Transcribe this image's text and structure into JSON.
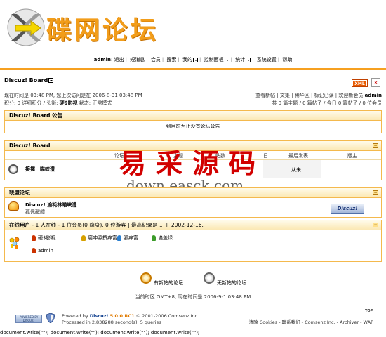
{
  "header": {
    "logo_text": "碟网论坛",
    "nav": {
      "user": "admin",
      "items": [
        "退出",
        "短消息",
        "会员",
        "搜索",
        "我的",
        "控制面板",
        "统计",
        "系统设置",
        "帮助"
      ]
    },
    "xml_badge": "XML",
    "close": "×"
  },
  "board": {
    "title": "Discuz! Board",
    "time_line": "现在时间是 03:48 PM, 您上次访问是在 2006-8-31 03:48 PM",
    "points_line_prefix": "积分: 0 详细积分 / 头衔: ",
    "points_rank": "硬$影视",
    "points_line_suffix": " 状态: 正常模式",
    "right_links": "查看新帖 | 文集 | 稀华区 | 标记已读 | 欢迎新会员",
    "new_member": "admin",
    "stats": "共 0 篇主题 / 0 篇帖子 / 今日 0 篇帖子 / 0 位会员"
  },
  "announcement": {
    "title": "Discuz! Board 公告",
    "text": "到目前为止没有论坛公告"
  },
  "forum_section": {
    "title": "Discuz! Board",
    "columns": [
      "论坛",
      "主题",
      "帖数",
      "日",
      "最后发表",
      "版主"
    ],
    "forum_name": "接擇　瞄峡澧",
    "last_post": "从未"
  },
  "links_section": {
    "title": "联盟论坛",
    "name": "Discuz! 渝牦林瞄峡澧",
    "desc": "孤佩醒鳢",
    "badge": "Discuz!"
  },
  "online": {
    "title_prefix": "在线用户",
    "title_rest": " - 1 人在线 - 1 位会员(0 隐身), 0 位游客 | 最高纪录是 1 于 2002-12-16.",
    "groups": [
      "硬$影视",
      "瘸呻瀛撰瘅富",
      "膈瘅富",
      "诶盖绿"
    ],
    "users": [
      "admin"
    ]
  },
  "legend": {
    "new": "有新帖的论坛",
    "none": "无新帖的论坛"
  },
  "timezone": "当前时区 GMT+8, 现在时间是 2006-9-1 03:48 PM",
  "footer": {
    "badge1": "POWERED BY DISCUZ!",
    "powered_prefix": "Powered by ",
    "product": "Discuz!",
    "version": "5.0.0 RC1",
    "copyright": " © 2001-2006 Comsenz Inc.",
    "processed": "Processed in 2.838288 second(s), 5 queries",
    "right_links": "清除 Cookies - 联系我们 - Comsenz Inc. - Archiver - WAP",
    "top": "TOP"
  },
  "watermark": {
    "cn": "易采源码",
    "en": "down.easck.com"
  },
  "docwrite": "document.write(\"\"); document.write(\"\"); document.write(\"\"); document.write(\"\");",
  "colors": {
    "accent": "#f6a020",
    "section_border": "#f4b94d",
    "watermark": "#d20000"
  }
}
